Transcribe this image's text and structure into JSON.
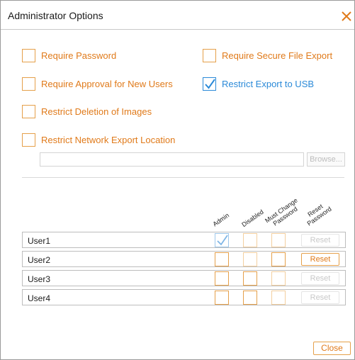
{
  "dialog": {
    "title": "Administrator Options",
    "close_icon": "close-x-icon"
  },
  "options": {
    "require_password": {
      "label": "Require Password",
      "checked": false
    },
    "require_secure_export": {
      "label": "Require Secure File Export",
      "checked": false
    },
    "require_approval": {
      "label": "Require Approval for New Users",
      "checked": false
    },
    "restrict_usb": {
      "label": "Restrict Export to USB",
      "checked": true
    },
    "restrict_deletion": {
      "label": "Restrict Deletion of Images",
      "checked": false
    },
    "restrict_network": {
      "label": "Restrict Network Export Location",
      "checked": false
    }
  },
  "network_path": {
    "value": "",
    "browse_label": "Browse..."
  },
  "columns": {
    "admin": "Admin",
    "disabled": "Disabled",
    "must_change_1": "Must Change",
    "must_change_2": "Password",
    "reset_1": "Reset",
    "reset_2": "Password"
  },
  "users": [
    {
      "name": "User1",
      "admin": true,
      "disabled": false,
      "must_change": false,
      "reset_label": "Reset",
      "reset_enabled": false
    },
    {
      "name": "User2",
      "admin": false,
      "disabled": false,
      "must_change": false,
      "reset_label": "Reset",
      "reset_enabled": true
    },
    {
      "name": "User3",
      "admin": false,
      "disabled": false,
      "must_change": false,
      "reset_label": "Reset",
      "reset_enabled": false
    },
    {
      "name": "User4",
      "admin": false,
      "disabled": false,
      "must_change": false,
      "reset_label": "Reset",
      "reset_enabled": false
    }
  ],
  "footer": {
    "close_label": "Close"
  },
  "colors": {
    "accent_orange": "#e07a1a",
    "checkbox_orange": "#e5a04a",
    "accent_blue": "#2b8ad8"
  }
}
